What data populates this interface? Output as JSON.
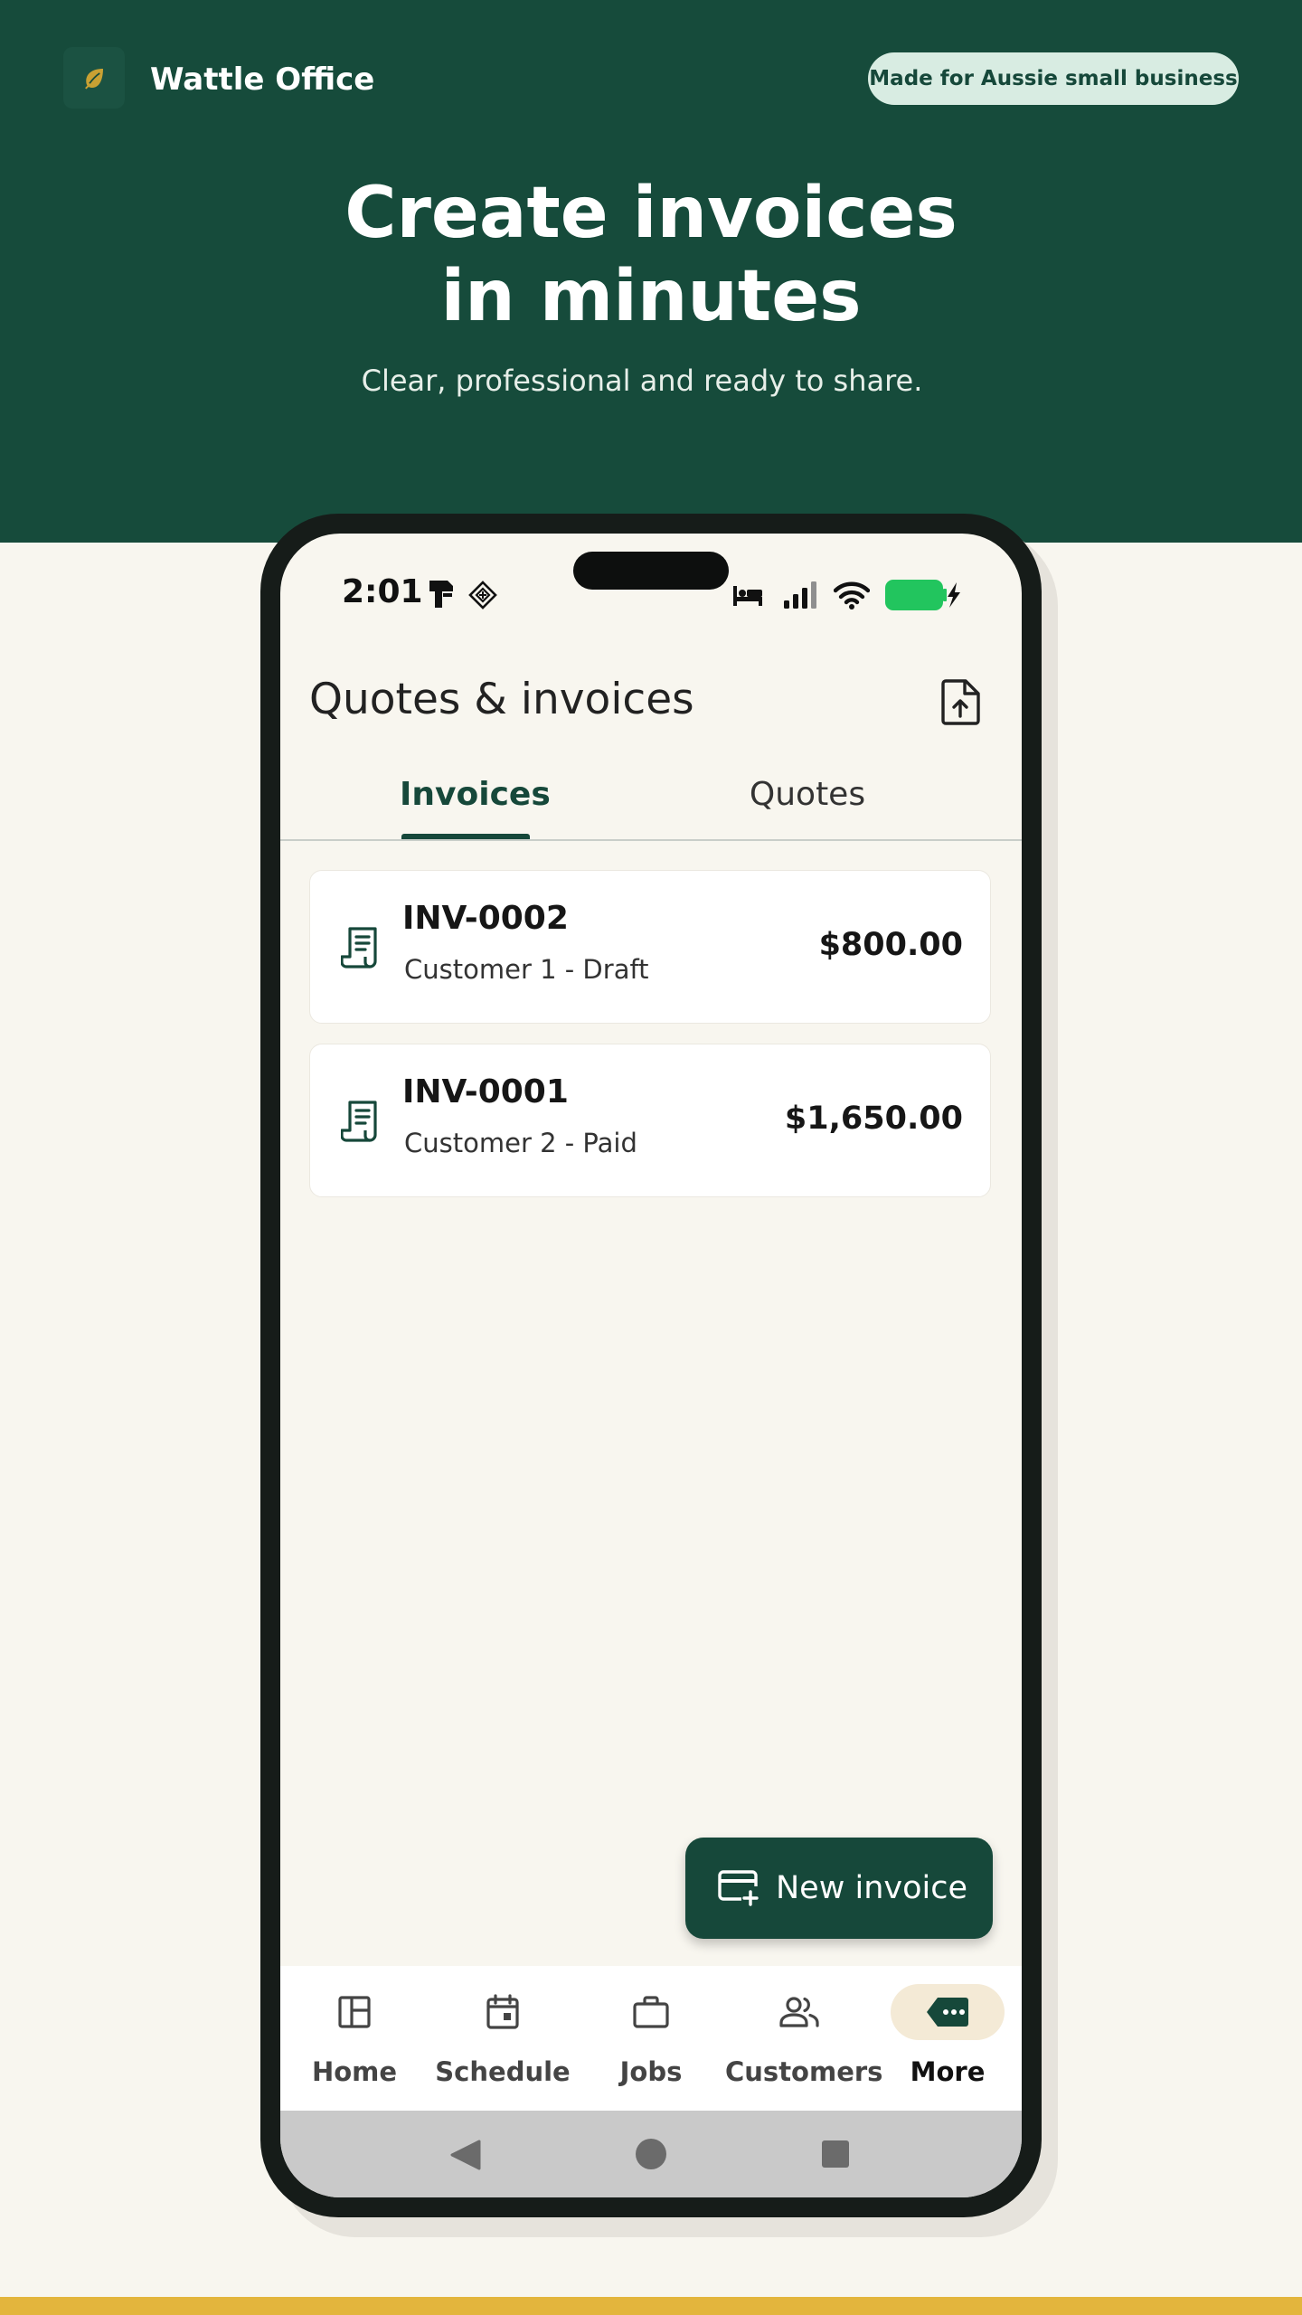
{
  "brand": {
    "name": "Wattle Office",
    "logo_icon": "leaf-icon"
  },
  "badge": "Made for Aussie small business",
  "hero": {
    "headline_line1": "Create invoices",
    "headline_line2": "in minutes",
    "subheading": "Clear, professional and ready to share."
  },
  "phone": {
    "status_bar": {
      "time": "2:01",
      "left_icons": [
        "sim-card-icon",
        "diamond-grid-icon"
      ],
      "right_icons": [
        "sleep-bed-icon",
        "signal-icon",
        "wifi-icon",
        "battery-charging-icon"
      ],
      "battery_color": "#22c55e"
    },
    "app": {
      "title": "Quotes & invoices",
      "action_icon": "file-upload-icon",
      "tabs": [
        {
          "label": "Invoices",
          "active": true
        },
        {
          "label": "Quotes",
          "active": false
        }
      ],
      "invoices": [
        {
          "number": "INV-0002",
          "subtitle": "Customer 1 - Draft",
          "amount": "$800.00",
          "icon": "receipt-icon"
        },
        {
          "number": "INV-0001",
          "subtitle": "Customer 2 - Paid",
          "amount": "$1,650.00",
          "icon": "receipt-icon"
        }
      ],
      "fab": {
        "label": "New invoice",
        "icon": "card-add-icon"
      },
      "bottom_nav": [
        {
          "label": "Home",
          "icon": "dashboard-icon",
          "active": false
        },
        {
          "label": "Schedule",
          "icon": "calendar-icon",
          "active": false
        },
        {
          "label": "Jobs",
          "icon": "briefcase-icon",
          "active": false
        },
        {
          "label": "Customers",
          "icon": "people-icon",
          "active": false
        },
        {
          "label": "More",
          "icon": "tag-more-icon",
          "active": true
        }
      ],
      "system_nav": [
        "back-icon",
        "home-circle-icon",
        "recents-icon"
      ]
    }
  },
  "colors": {
    "brand_green": "#164b3b",
    "background_cream": "#f8f6ef",
    "accent_gold": "#e3b53d",
    "badge_bg": "#d8ece2",
    "active_nav_bg": "#f4ead6"
  }
}
